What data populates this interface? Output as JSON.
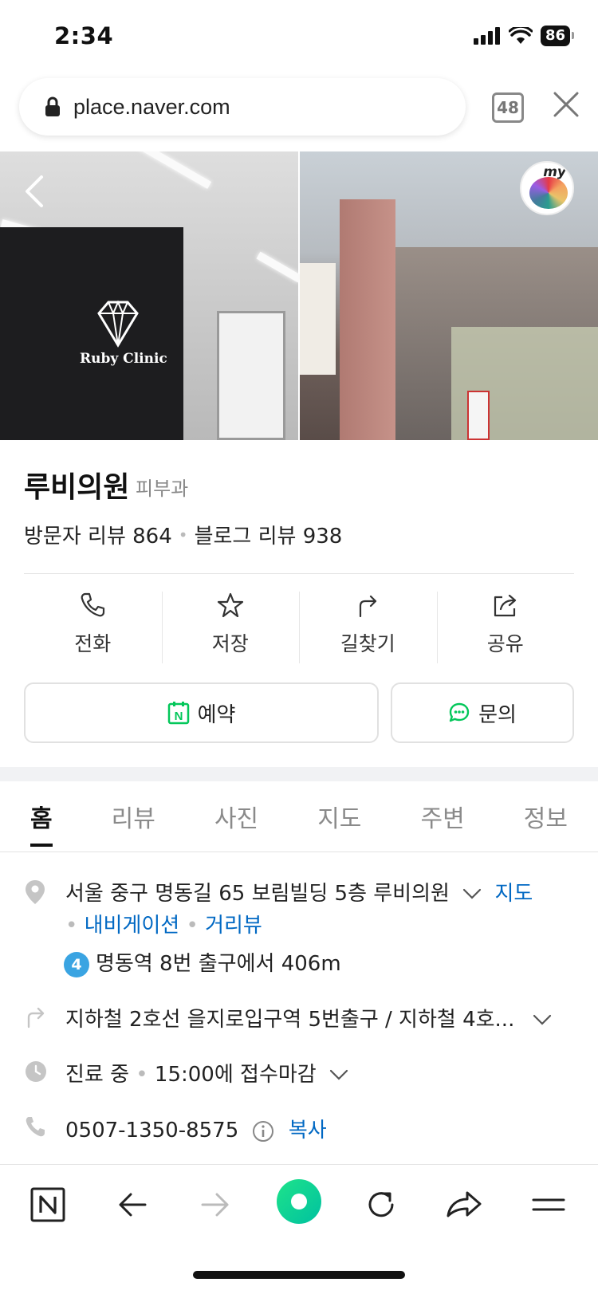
{
  "status_bar": {
    "time": "2:34",
    "battery": "86"
  },
  "browser": {
    "url": "place.naver.com",
    "tab_count": "48"
  },
  "hero": {
    "left_sign": "Ruby Clinic",
    "badge_text": "my"
  },
  "place": {
    "name": "루비의원",
    "category": "피부과",
    "visitor_reviews": "방문자 리뷰 864",
    "blog_reviews": "블로그 리뷰 938"
  },
  "actions": [
    {
      "label": "전화",
      "icon": "phone-icon"
    },
    {
      "label": "저장",
      "icon": "star-icon"
    },
    {
      "label": "길찾기",
      "icon": "directions-icon"
    },
    {
      "label": "공유",
      "icon": "share-icon"
    }
  ],
  "buttons": {
    "reserve": "예약",
    "inquiry": "문의",
    "naver_calendar_letter": "N"
  },
  "tabs": [
    "홈",
    "리뷰",
    "사진",
    "지도",
    "주변",
    "정보"
  ],
  "info": {
    "address": "서울 중구 명동길 65 보림빌딩 5층 루비의원",
    "map_link": "지도",
    "navigation_link": "내비게이션",
    "streetview_link": "거리뷰",
    "subway_line": "4",
    "subway_exit": "명동역 8번 출구에서 406m",
    "directions": "지하철 2호선 을지로입구역 5번출구 / 지하철 4호...",
    "hours_status": "진료 중",
    "hours_detail": "15:00에 접수마감",
    "phone": "0507-1350-8575",
    "copy_label": "복사"
  },
  "colors": {
    "naver_green": "#03c75a",
    "link_blue": "#0068c3",
    "subway_line4": "#3aa4e2"
  }
}
